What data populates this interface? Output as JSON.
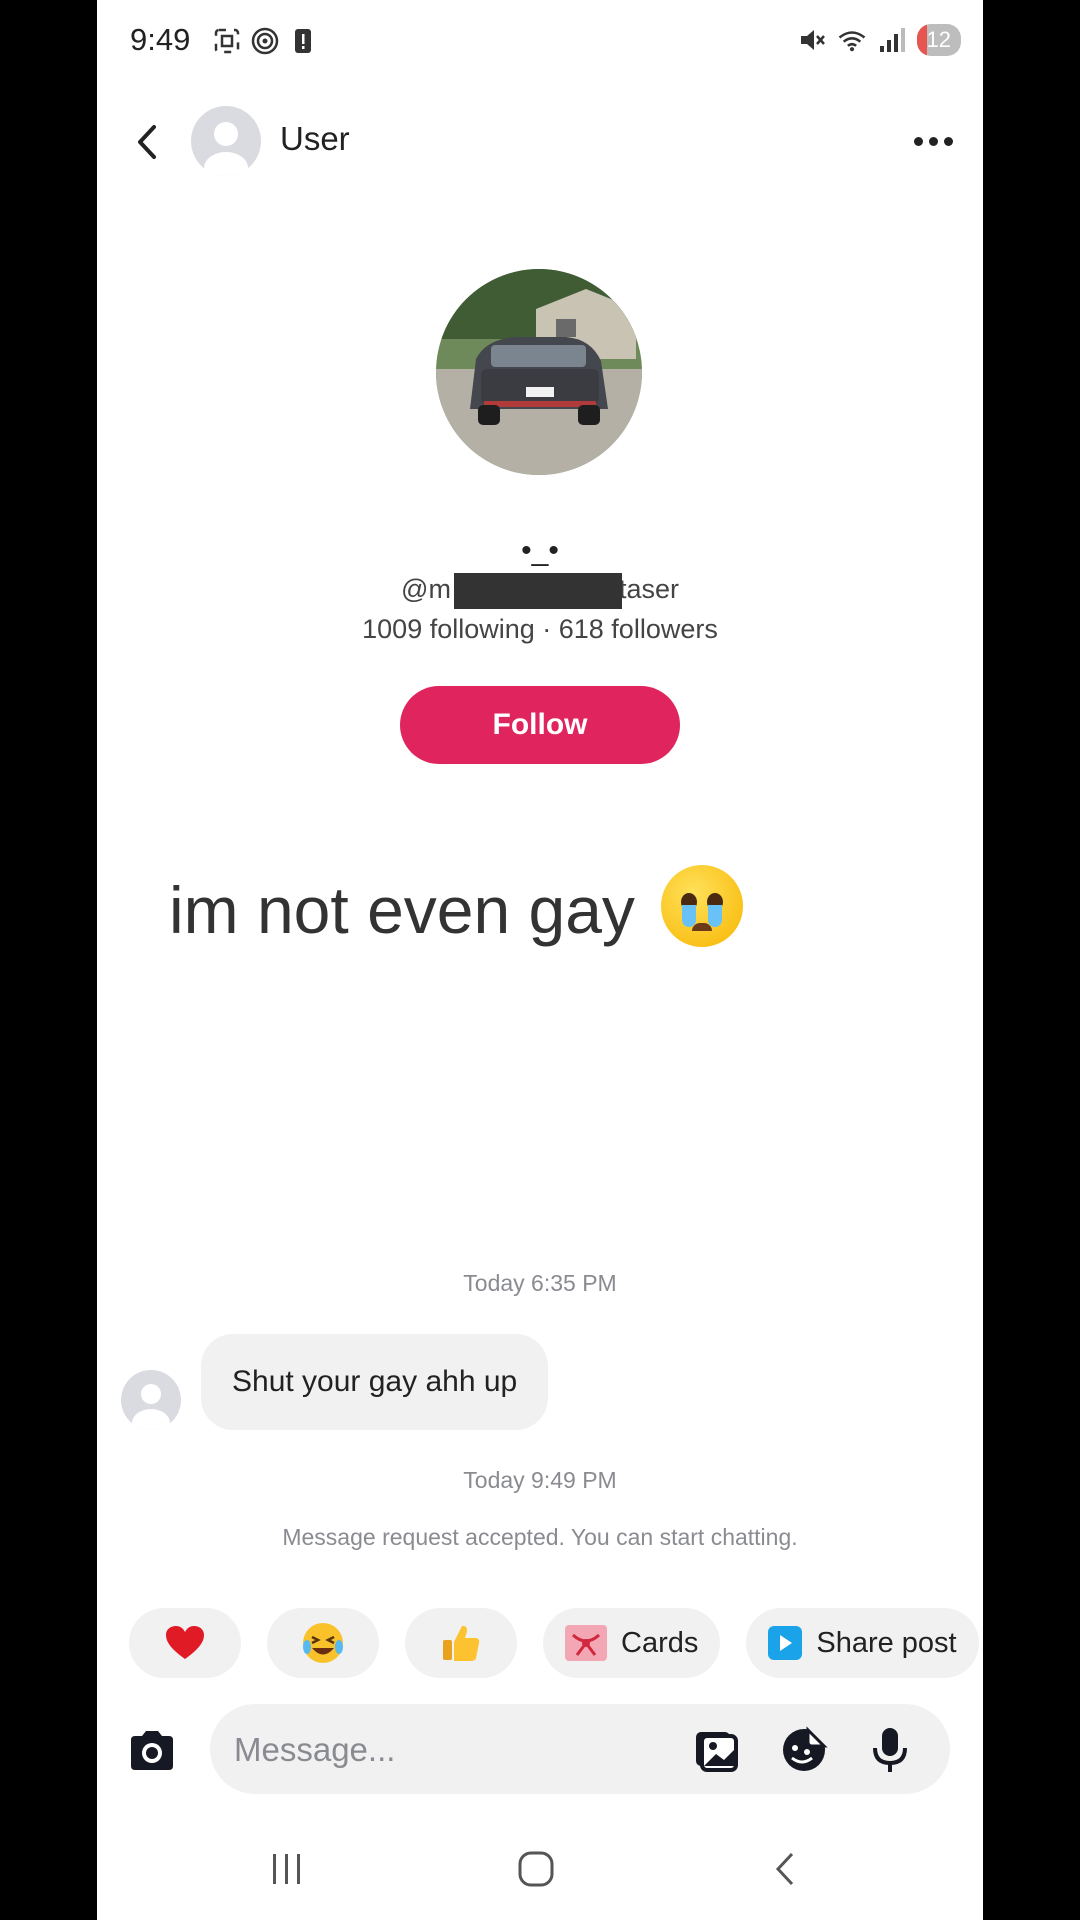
{
  "status_bar": {
    "time": "9:49",
    "battery": "12",
    "icons": [
      "screenshot-icon",
      "hotspot-icon",
      "alert-icon",
      "mute-icon",
      "wifi-icon",
      "signal-icon",
      "battery-icon"
    ]
  },
  "header": {
    "title": "User"
  },
  "profile": {
    "nickname": "•_•",
    "handle_prefix": "@m",
    "handle_suffix": "taser",
    "stats": "1009 following · 618 followers",
    "follow_label": "Follow"
  },
  "featured_message": {
    "text": "im not even gay",
    "emoji": "crying-face-emoji"
  },
  "chat": {
    "timestamp_1": "Today 6:35 PM",
    "message_1": "Shut your gay ahh up",
    "timestamp_2": "Today 9:49 PM",
    "system_notice": "Message request accepted. You can start chatting."
  },
  "quick_replies": {
    "cards_label": "Cards",
    "share_label": "Share post",
    "emojis": [
      "heart-emoji",
      "laughing-emoji",
      "thumbs-up-emoji"
    ]
  },
  "composer": {
    "placeholder": "Message..."
  },
  "colors": {
    "accent": "#e0245e",
    "bubble": "#f1f1f2",
    "muted_text": "#8a8b91"
  }
}
